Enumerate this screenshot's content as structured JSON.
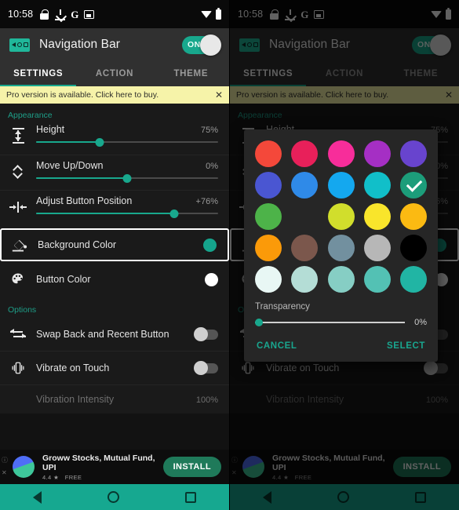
{
  "status_bar": {
    "time": "10:58",
    "left_icons": [
      "lock-icon",
      "download-icon",
      "google-icon",
      "screenshot-icon"
    ],
    "right_icons": [
      "wifi-icon",
      "battery-icon"
    ]
  },
  "app_bar": {
    "logo": "navigation-bar-logo",
    "title": "Navigation Bar",
    "switch_label": "ON",
    "switch_on": true,
    "accent": "#18a88d"
  },
  "tabs": [
    {
      "label": "SETTINGS",
      "active": true
    },
    {
      "label": "ACTION",
      "active": false
    },
    {
      "label": "THEME",
      "active": false
    }
  ],
  "pro_banner": {
    "text": "Pro version is available. Click here to buy.",
    "close_label": "✕",
    "bg": "#f6f3a9"
  },
  "sections": {
    "appearance_label": "Appearance",
    "options_label": "Options"
  },
  "settings": [
    {
      "icon": "height-icon",
      "title": "Height",
      "value": "75%",
      "fill": 35
    },
    {
      "icon": "move-updown-icon",
      "title": "Move Up/Down",
      "value": "0%",
      "fill": 50
    },
    {
      "icon": "adjust-position-icon",
      "title": "Adjust Button Position",
      "value": "+76%",
      "fill": 76
    }
  ],
  "color_rows": [
    {
      "icon": "paint-bucket-icon",
      "title": "Background Color",
      "swatch": "#15a48c",
      "highlighted": true
    },
    {
      "icon": "palette-icon",
      "title": "Button Color",
      "swatch": "#ffffff",
      "highlighted": false
    }
  ],
  "option_rows": [
    {
      "icon": "swap-icon",
      "title": "Swap Back and Recent Button",
      "toggle_on": false
    },
    {
      "icon": "vibrate-icon",
      "title": "Vibrate on Touch",
      "toggle_on": false
    }
  ],
  "dim_row": {
    "title": "Vibration Intensity",
    "value": "100%"
  },
  "ad": {
    "app_name": "Groww Stocks, Mutual Fund, UPI",
    "rating": "4.4",
    "star": "★",
    "price": "FREE",
    "button": "INSTALL",
    "info_icon": "ⓘ",
    "close_icon": "✕"
  },
  "nav_bar": {
    "back": "back-triangle-icon",
    "home": "home-circle-icon",
    "recents": "recents-square-icon",
    "bg": "#16a890"
  },
  "dialog": {
    "title": "color-picker-dialog",
    "palette_rows": [
      [
        "#f4483a",
        "#e8205a",
        "#f72d9a",
        "#a52fc4",
        "#6844ce"
      ],
      [
        "#4a56d2",
        "#2f8ae8",
        "#14a8ef",
        "#11bfc9",
        "#1c9d7a"
      ],
      [
        "#4db349",
        "#8dc council",
        "#d1de2c",
        "#f9e52b",
        "#fbba12"
      ],
      [
        "#fb9a09",
        "#7b574c",
        "#72909f",
        "#b7b7b7",
        "#000000"
      ],
      [
        "#e8f7f4",
        "#b4ddd6",
        "#86cec4",
        "#53c1b4",
        "#21b5a4"
      ]
    ],
    "selected_index": [
      1,
      4
    ],
    "transparency_label": "Transparency",
    "transparency_value": "0%",
    "transparency_percent": 0,
    "cancel_label": "CANCEL",
    "select_label": "SELECT"
  }
}
